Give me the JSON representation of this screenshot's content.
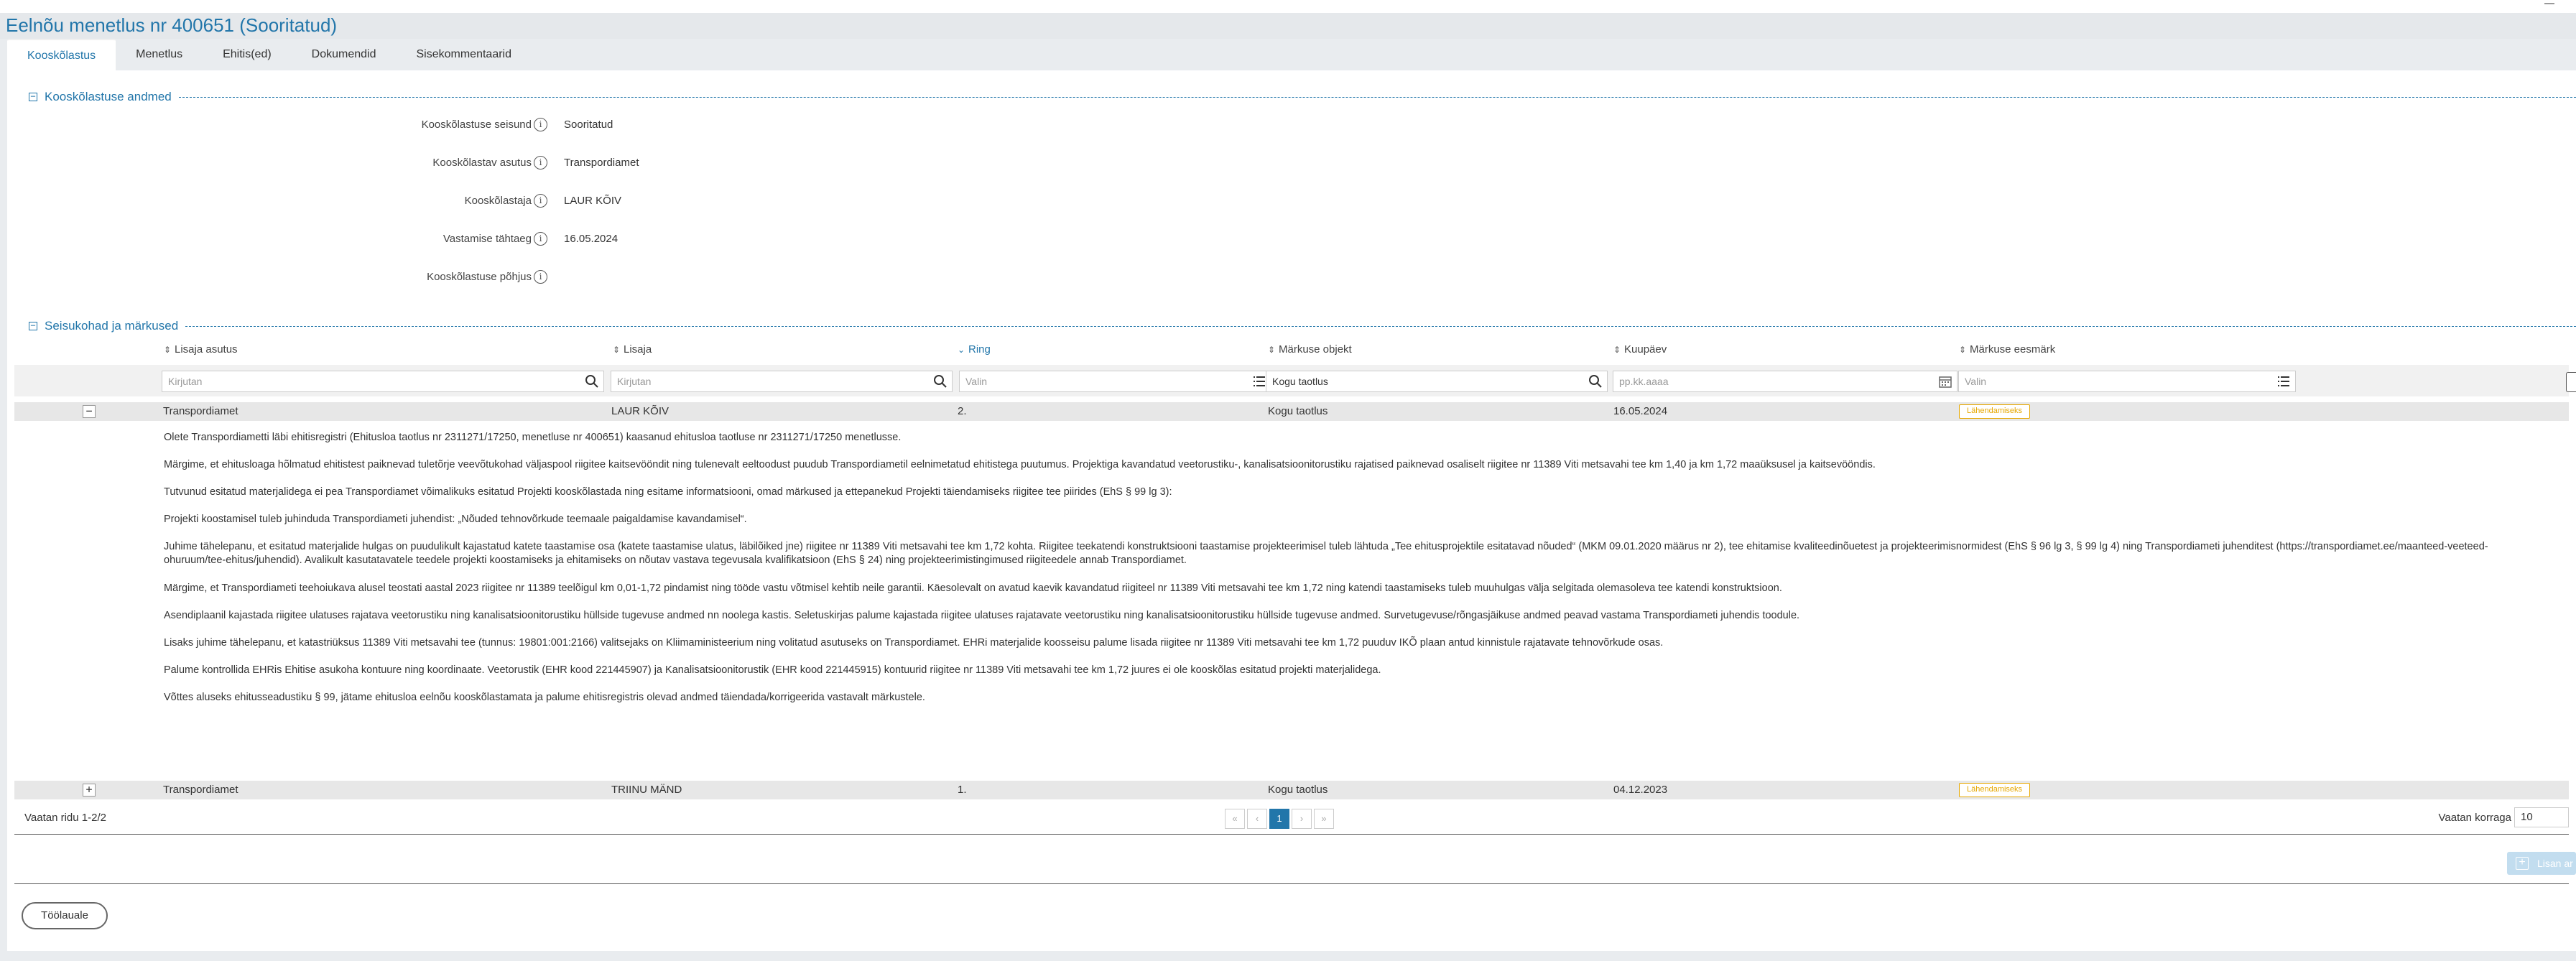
{
  "page": {
    "title": "Eelnõu menetlus nr 400651 (Sooritatud)"
  },
  "tabs": [
    {
      "label": "Kooskõlastus"
    },
    {
      "label": "Menetlus"
    },
    {
      "label": "Ehitis(ed)"
    },
    {
      "label": "Dokumendid"
    },
    {
      "label": "Sisekommentaarid"
    }
  ],
  "details_section": {
    "title": "Kooskõlastuse andmed",
    "fields": [
      {
        "label": "Kooskõlastuse seisund",
        "value": "Sooritatud"
      },
      {
        "label": "Kooskõlastav asutus",
        "value": "Transpordiamet"
      },
      {
        "label": "Kooskõlastaja",
        "value": "LAUR KÕIV"
      },
      {
        "label": "Vastamise tähtaeg",
        "value": "16.05.2024"
      },
      {
        "label": "Kooskõlastuse põhjus",
        "value": ""
      }
    ]
  },
  "opinions_section": {
    "title": "Seisukohad ja märkused",
    "columns": [
      "Lisaja asutus",
      "Lisaja",
      "Ring",
      "Märkuse objekt",
      "Kuupäev",
      "Märkuse eesmärk"
    ],
    "filters": {
      "agency": "Kirjutan",
      "author": "Kirjutan",
      "round": "Valin",
      "object": "Kogu taotlus",
      "date": "pp.kk.aaaa",
      "purpose": "Valin"
    },
    "rows": [
      {
        "expander": "−",
        "agency": "Transpordiamet",
        "author": "LAUR KÕIV",
        "round": "2.",
        "object": "Kogu taotlus",
        "date": "16.05.2024",
        "purpose": "Lähendamiseks",
        "comments": [
          "Olete Transpordiametti läbi ehitisregistri (Ehitusloa taotlus nr 2311271/17250, menetluse nr 400651) kaasanud ehitusloa taotluse nr 2311271/17250 menetlusse.",
          "Märgime, et ehitusloaga hõlmatud ehitistest paiknevad tuletõrje veevõtukohad väljaspool riigitee kaitsevööndit ning tulenevalt eeltoodust puudub Transpordiametil eelnimetatud ehitistega puutumus. Projektiga kavandatud veetorustiku-, kanalisatsioonitorustiku rajatised paiknevad osaliselt riigitee nr 11389 Viti metsavahi tee km 1,40 ja km 1,72 maaüksusel ja kaitsevööndis.",
          "Tutvunud esitatud materjalidega ei pea Transpordiamet võimalikuks esitatud Projekti kooskõlastada ning esitame informatsiooni, omad märkused ja ettepanekud Projekti täiendamiseks riigitee tee piirides (EhS § 99 lg 3):",
          "Projekti koostamisel tuleb juhinduda Transpordiameti juhendist: „Nõuded tehnovõrkude teemaale paigaldamise kavandamisel“.",
          "Juhime tähelepanu, et esitatud materjalide hulgas on puudulikult kajastatud katete taastamise osa (katete taastamise ulatus, läbilõiked jne) riigitee nr 11389 Viti metsavahi tee km 1,72 kohta. Riigitee teekatendi konstruktsiooni taastamise projekteerimisel tuleb lähtuda „Tee ehitusprojektile esitatavad nõuded“ (MKM 09.01.2020 määrus nr 2), tee ehitamise kvaliteedinõuetest ja projekteerimisnormidest (EhS § 96 lg 3, § 99 lg 4) ning Transpordiameti juhenditest (https://transpordiamet.ee/maanteed-veeteed-ohuruum/tee-ehitus/juhendid). Avalikult kasutatavatele teedele projekti koostamiseks ja ehitamiseks on nõutav vastava tegevusala kvalifikatsioon (EhS § 24) ning projekteerimistingimused riigiteedele annab Transpordiamet.",
          "Märgime, et Transpordiameti teehoiukava alusel teostati aastal 2023 riigitee nr 11389 teelõigul km 0,01-1,72 pindamist ning tööde vastu võtmisel kehtib neile garantii. Käesolevalt on avatud kaevik kavandatud riigiteel nr 11389 Viti metsavahi tee km 1,72 ning katendi taastamiseks tuleb muuhulgas välja selgitada olemasoleva tee katendi konstruktsioon.",
          "Asendiplaanil kajastada riigitee ulatuses rajatava veetorustiku ning kanalisatsioonitorustiku hüllside tugevuse andmed nn noolega kastis. Seletuskirjas palume kajastada riigitee ulatuses rajatavate veetorustiku ning kanalisatsioonitorustiku hüllside tugevuse andmed. Survetugevuse/rõngasjäikuse andmed peavad vastama Transpordiameti juhendis toodule.",
          "Lisaks juhime tähelepanu, et katastriüksus 11389 Viti metsavahi tee (tunnus: 19801:001:2166) valitsejaks on Kliimaministeerium ning volitatud asutuseks on Transpordiamet. EHRi materjalide koosseisu palume lisada riigitee nr 11389 Viti metsavahi tee km 1,72 puuduv IKÕ plaan antud kinnistule rajatavate tehnovõrkude osas.",
          "Palume kontrollida EHRis Ehitise asukoha kontuure ning koordinaate. Veetorustik (EHR kood 221445907) ja Kanalisatsioonitorustik (EHR kood 221445915) kontuurid riigitee nr 11389 Viti metsavahi tee km 1,72 juures ei ole kooskõlas esitatud projekti materjalidega.",
          "Võttes aluseks ehitusseadustiku § 99, jätame ehitusloa eelnõu kooskõlastamata ja palume ehitisregistris olevad andmed täiendada/korrigeerida vastavalt märkustele."
        ]
      },
      {
        "expander": "+",
        "agency": "Transpordiamet",
        "author": "TRIINU MÄND",
        "round": "1.",
        "object": "Kogu taotlus",
        "date": "04.12.2023",
        "purpose": "Lähendamiseks"
      }
    ],
    "pager": {
      "summary": "Vaatan ridu 1-2/2",
      "first": "«",
      "prev": "‹",
      "current": "1",
      "next": "›",
      "last": "»",
      "page_size_label": "Vaatan korraga",
      "page_size": "10"
    },
    "add_label": "Lisan ar"
  },
  "footer": {
    "back_label": "Töölauale"
  },
  "colors": {
    "accent": "#2276aa",
    "badge": "#e6a700"
  }
}
